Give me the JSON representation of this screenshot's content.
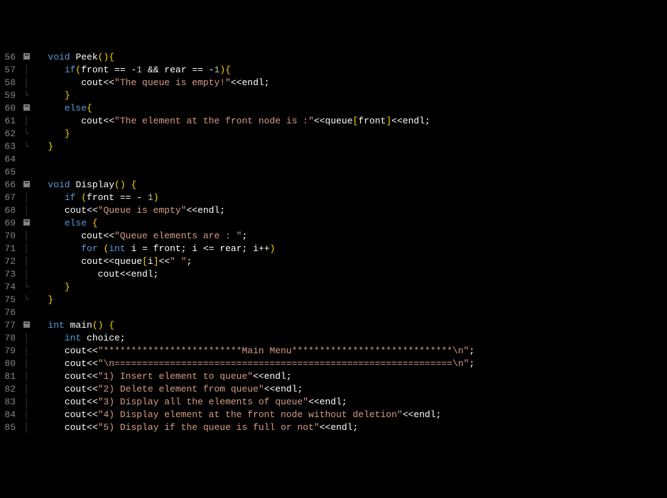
{
  "lines": [
    {
      "num": "56",
      "fold": "box",
      "indent": 1,
      "tokens": [
        [
          "tk-type",
          "void"
        ],
        [
          "tk-white",
          " "
        ],
        [
          "tk-func",
          "Peek"
        ],
        [
          "tk-yellow",
          "()"
        ],
        [
          "tk-brace",
          "{"
        ]
      ]
    },
    {
      "num": "57",
      "fold": "pipe",
      "indent": 2,
      "tokens": [
        [
          "tk-keyword",
          "if"
        ],
        [
          "tk-yellow",
          "("
        ],
        [
          "tk-white",
          "front "
        ],
        [
          "tk-white",
          "== "
        ],
        [
          "tk-white",
          "-"
        ],
        [
          "tk-num",
          "1"
        ],
        [
          "tk-white",
          " "
        ],
        [
          "tk-white",
          "&&"
        ],
        [
          "tk-white",
          " rear "
        ],
        [
          "tk-white",
          "== "
        ],
        [
          "tk-white",
          "-"
        ],
        [
          "tk-num",
          "1"
        ],
        [
          "tk-yellow",
          ")"
        ],
        [
          "tk-brace",
          "{"
        ]
      ]
    },
    {
      "num": "58",
      "fold": "pipe",
      "indent": 3,
      "tokens": [
        [
          "tk-white",
          "cout"
        ],
        [
          "tk-white",
          "<<"
        ],
        [
          "tk-strlit",
          "\"The queue is empty!\""
        ],
        [
          "tk-white",
          "<<"
        ],
        [
          "tk-white",
          "endl"
        ],
        [
          "tk-white",
          ";"
        ]
      ]
    },
    {
      "num": "59",
      "fold": "end",
      "indent": 2,
      "tokens": [
        [
          "tk-brace",
          "}"
        ]
      ]
    },
    {
      "num": "60",
      "fold": "box",
      "indent": 2,
      "tokens": [
        [
          "tk-keyword",
          "else"
        ],
        [
          "tk-brace",
          "{"
        ]
      ]
    },
    {
      "num": "61",
      "fold": "pipe",
      "indent": 3,
      "tokens": [
        [
          "tk-white",
          "cout"
        ],
        [
          "tk-white",
          "<<"
        ],
        [
          "tk-strlit",
          "\"The element at the front node is :\""
        ],
        [
          "tk-white",
          "<<"
        ],
        [
          "tk-white",
          "queue"
        ],
        [
          "tk-yellow",
          "["
        ],
        [
          "tk-white",
          "front"
        ],
        [
          "tk-yellow",
          "]"
        ],
        [
          "tk-white",
          "<<"
        ],
        [
          "tk-white",
          "endl"
        ],
        [
          "tk-white",
          ";"
        ]
      ]
    },
    {
      "num": "62",
      "fold": "end",
      "indent": 2,
      "tokens": [
        [
          "tk-brace",
          "}"
        ]
      ]
    },
    {
      "num": "63",
      "fold": "end",
      "indent": 1,
      "tokens": [
        [
          "tk-brace",
          "}"
        ]
      ]
    },
    {
      "num": "64",
      "fold": "",
      "indent": 0,
      "tokens": []
    },
    {
      "num": "65",
      "fold": "",
      "indent": 0,
      "tokens": []
    },
    {
      "num": "66",
      "fold": "box",
      "indent": 1,
      "tokens": [
        [
          "tk-type",
          "void"
        ],
        [
          "tk-white",
          " "
        ],
        [
          "tk-func",
          "Display"
        ],
        [
          "tk-yellow",
          "()"
        ],
        [
          "tk-white",
          " "
        ],
        [
          "tk-brace",
          "{"
        ]
      ]
    },
    {
      "num": "67",
      "fold": "pipe",
      "indent": 2,
      "tokens": [
        [
          "tk-keyword",
          "if"
        ],
        [
          "tk-white",
          " "
        ],
        [
          "tk-yellow",
          "("
        ],
        [
          "tk-white",
          "front "
        ],
        [
          "tk-white",
          "== "
        ],
        [
          "tk-white",
          "- "
        ],
        [
          "tk-num",
          "1"
        ],
        [
          "tk-yellow",
          ")"
        ]
      ]
    },
    {
      "num": "68",
      "fold": "pipe",
      "indent": 2,
      "tokens": [
        [
          "tk-white",
          "cout"
        ],
        [
          "tk-white",
          "<<"
        ],
        [
          "tk-strlit",
          "\"Queue is empty\""
        ],
        [
          "tk-white",
          "<<"
        ],
        [
          "tk-white",
          "endl"
        ],
        [
          "tk-white",
          ";"
        ]
      ]
    },
    {
      "num": "69",
      "fold": "box",
      "indent": 2,
      "tokens": [
        [
          "tk-keyword",
          "else"
        ],
        [
          "tk-white",
          " "
        ],
        [
          "tk-brace",
          "{"
        ]
      ]
    },
    {
      "num": "70",
      "fold": "pipe",
      "indent": 3,
      "tokens": [
        [
          "tk-white",
          "cout"
        ],
        [
          "tk-white",
          "<<"
        ],
        [
          "tk-strlit",
          "\"Queue elements are : \""
        ],
        [
          "tk-white",
          ";"
        ]
      ]
    },
    {
      "num": "71",
      "fold": "pipe",
      "indent": 3,
      "tokens": [
        [
          "tk-keyword",
          "for"
        ],
        [
          "tk-white",
          " "
        ],
        [
          "tk-yellow",
          "("
        ],
        [
          "tk-type",
          "int"
        ],
        [
          "tk-white",
          " i "
        ],
        [
          "tk-white",
          "= "
        ],
        [
          "tk-white",
          "front"
        ],
        [
          "tk-white",
          "; "
        ],
        [
          "tk-white",
          "i "
        ],
        [
          "tk-white",
          "<= "
        ],
        [
          "tk-white",
          "rear"
        ],
        [
          "tk-white",
          "; "
        ],
        [
          "tk-white",
          "i"
        ],
        [
          "tk-white",
          "++"
        ],
        [
          "tk-yellow",
          ")"
        ]
      ]
    },
    {
      "num": "72",
      "fold": "pipe",
      "indent": 3,
      "tokens": [
        [
          "tk-white",
          "cout"
        ],
        [
          "tk-white",
          "<<"
        ],
        [
          "tk-white",
          "queue"
        ],
        [
          "tk-yellow",
          "["
        ],
        [
          "tk-white",
          "i"
        ],
        [
          "tk-yellow",
          "]"
        ],
        [
          "tk-white",
          "<<"
        ],
        [
          "tk-strlit",
          "\" \""
        ],
        [
          "tk-white",
          ";"
        ]
      ]
    },
    {
      "num": "73",
      "fold": "pipe",
      "indent": 4,
      "tokens": [
        [
          "tk-white",
          "cout"
        ],
        [
          "tk-white",
          "<<"
        ],
        [
          "tk-white",
          "endl"
        ],
        [
          "tk-white",
          ";"
        ]
      ]
    },
    {
      "num": "74",
      "fold": "end",
      "indent": 2,
      "tokens": [
        [
          "tk-brace",
          "}"
        ]
      ]
    },
    {
      "num": "75",
      "fold": "end",
      "indent": 1,
      "tokens": [
        [
          "tk-brace",
          "}"
        ]
      ]
    },
    {
      "num": "76",
      "fold": "",
      "indent": 0,
      "tokens": []
    },
    {
      "num": "77",
      "fold": "box",
      "indent": 1,
      "tokens": [
        [
          "tk-type",
          "int"
        ],
        [
          "tk-white",
          " "
        ],
        [
          "tk-func",
          "main"
        ],
        [
          "tk-yellow",
          "()"
        ],
        [
          "tk-white",
          " "
        ],
        [
          "tk-brace",
          "{"
        ]
      ]
    },
    {
      "num": "78",
      "fold": "pipe",
      "indent": 2,
      "tokens": [
        [
          "tk-type",
          "int"
        ],
        [
          "tk-white",
          " choice"
        ],
        [
          "tk-white",
          ";"
        ]
      ]
    },
    {
      "num": "79",
      "fold": "pipe",
      "indent": 2,
      "tokens": [
        [
          "tk-white",
          "cout"
        ],
        [
          "tk-white",
          "<<"
        ],
        [
          "tk-strlit",
          "\"*************************Main Menu*****************************\\n\""
        ],
        [
          "tk-white",
          ";"
        ]
      ]
    },
    {
      "num": "80",
      "fold": "pipe",
      "indent": 2,
      "tokens": [
        [
          "tk-white",
          "cout"
        ],
        [
          "tk-white",
          "<<"
        ],
        [
          "tk-strlit",
          "\"\\n=============================================================\\n\""
        ],
        [
          "tk-white",
          ";"
        ]
      ]
    },
    {
      "num": "81",
      "fold": "pipe",
      "indent": 2,
      "tokens": [
        [
          "tk-white",
          "cout"
        ],
        [
          "tk-white",
          "<<"
        ],
        [
          "tk-strlit",
          "\"1) Insert element to queue\""
        ],
        [
          "tk-white",
          "<<"
        ],
        [
          "tk-white",
          "endl"
        ],
        [
          "tk-white",
          ";"
        ]
      ]
    },
    {
      "num": "82",
      "fold": "pipe",
      "indent": 2,
      "tokens": [
        [
          "tk-white",
          "cout"
        ],
        [
          "tk-white",
          "<<"
        ],
        [
          "tk-strlit",
          "\"2) Delete element from queue\""
        ],
        [
          "tk-white",
          "<<"
        ],
        [
          "tk-white",
          "endl"
        ],
        [
          "tk-white",
          ";"
        ]
      ]
    },
    {
      "num": "83",
      "fold": "pipe",
      "indent": 2,
      "tokens": [
        [
          "tk-white",
          "cout"
        ],
        [
          "tk-white",
          "<<"
        ],
        [
          "tk-strlit",
          "\"3) Display all the elements of queue\""
        ],
        [
          "tk-white",
          "<<"
        ],
        [
          "tk-white",
          "endl"
        ],
        [
          "tk-white",
          ";"
        ]
      ]
    },
    {
      "num": "84",
      "fold": "pipe",
      "indent": 2,
      "tokens": [
        [
          "tk-white",
          "cout"
        ],
        [
          "tk-white",
          "<<"
        ],
        [
          "tk-strlit",
          "\"4) Display element at the front node without deletion\""
        ],
        [
          "tk-white",
          "<<"
        ],
        [
          "tk-white",
          "endl"
        ],
        [
          "tk-white",
          ";"
        ]
      ]
    },
    {
      "num": "85",
      "fold": "pipe",
      "indent": 2,
      "tokens": [
        [
          "tk-white",
          "cout"
        ],
        [
          "tk-white",
          "<<"
        ],
        [
          "tk-strlit",
          "\"5) Display if the queue is full or not\""
        ],
        [
          "tk-white",
          "<<"
        ],
        [
          "tk-white",
          "endl"
        ],
        [
          "tk-white",
          ";"
        ]
      ]
    }
  ]
}
